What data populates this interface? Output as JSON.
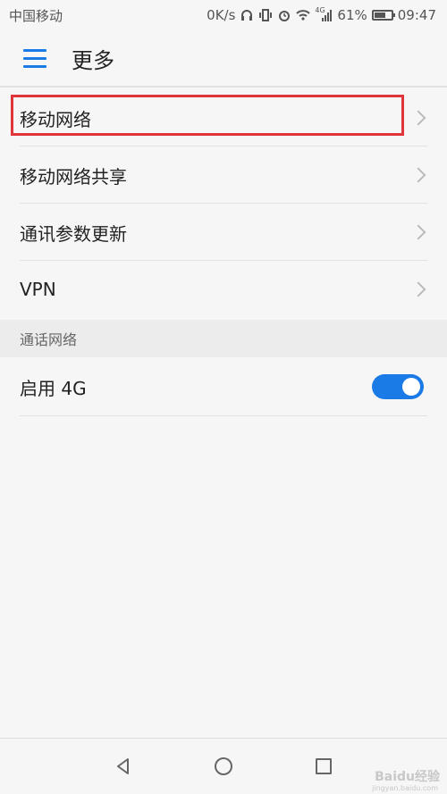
{
  "status_bar": {
    "carrier": "中国移动",
    "speed": "0K/s",
    "signal_label": "4G",
    "battery": "61%",
    "time": "09:47",
    "icons": [
      "headphone-icon",
      "vibrate-icon",
      "alarm-icon",
      "wifi-icon",
      "signal-icon",
      "battery-icon"
    ]
  },
  "header": {
    "title": "更多",
    "menu_icon": "menu-icon"
  },
  "list": {
    "items": [
      {
        "label": "移动网络",
        "highlighted": true
      },
      {
        "label": "移动网络共享"
      },
      {
        "label": "通讯参数更新"
      },
      {
        "label": "VPN"
      }
    ]
  },
  "section": {
    "title": "通话网络"
  },
  "toggle_row": {
    "label": "启用 4G",
    "enabled": true
  },
  "colors": {
    "accent": "#1a7ae6",
    "highlight": "#e0353b"
  },
  "nav": {
    "icons": [
      "back-icon",
      "home-icon",
      "recent-apps-icon"
    ]
  },
  "watermark": {
    "text": "Baidu经验",
    "sub": "jingyan.baidu.com"
  }
}
